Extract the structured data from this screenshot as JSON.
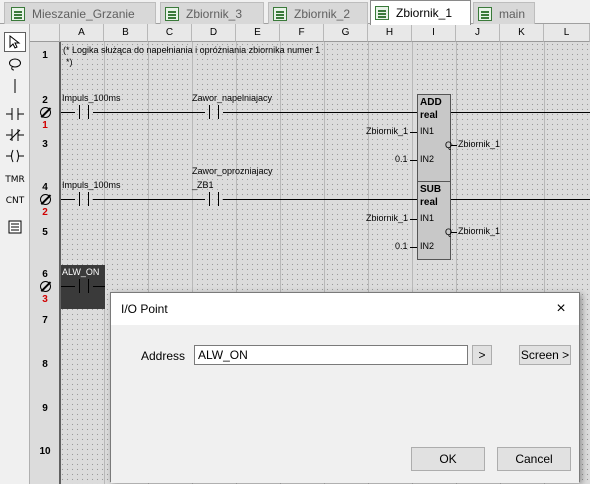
{
  "tabs": [
    {
      "label": "Mieszanie_Grzanie",
      "active": false
    },
    {
      "label": "Zbiornik_3",
      "active": false
    },
    {
      "label": "Zbiornik_2",
      "active": false
    },
    {
      "label": "Zbiornik_1",
      "active": true
    },
    {
      "label": "main",
      "active": false
    }
  ],
  "toolbar": {
    "tools": [
      "select-arrow",
      "lasso",
      "vertical-line",
      "-| |-",
      "-|/|-",
      "-( )-",
      "TMR",
      "CNT",
      "list"
    ]
  },
  "columns": [
    "A",
    "B",
    "C",
    "D",
    "E",
    "F",
    "G",
    "H",
    "I",
    "J",
    "K",
    "L"
  ],
  "rows": [
    "1",
    "2",
    "3",
    "4",
    "5",
    "6",
    "7",
    "8",
    "9",
    "10"
  ],
  "rung_numbers": [
    "1",
    "2",
    "3"
  ],
  "comment": {
    "line1": "(* Logika służąca do napełniania i opróżniania zbiornika numer 1",
    "line2": "*)"
  },
  "rung1": {
    "contact1": "Impuls_100ms",
    "contact2": "Zawor_napelniajacy",
    "block_op": "ADD",
    "block_type": "real",
    "in1_var": "Zbiornik_1",
    "in1_label": "IN1",
    "in2_var": "0.1",
    "in2_label": "IN2",
    "q_label": "Q",
    "q_var": "Zbiornik_1"
  },
  "rung2": {
    "contact1": "Impuls_100ms",
    "contact2_line1": "Zawor_oprozniajacy",
    "contact2_line2": "_ZB1",
    "block_op": "SUB",
    "block_type": "real",
    "in1_var": "Zbiornik_1",
    "in1_label": "IN1",
    "in2_var": "0.1",
    "in2_label": "IN2",
    "q_label": "Q",
    "q_var": "Zbiornik_1"
  },
  "rung3": {
    "contact1": "ALW_ON"
  },
  "dialog": {
    "title": "I/O Point",
    "address_label": "Address",
    "address_value": "ALW_ON",
    "browse_label": ">",
    "screen_label": "Screen >",
    "ok_label": "OK",
    "cancel_label": "Cancel",
    "close_icon": "×"
  }
}
